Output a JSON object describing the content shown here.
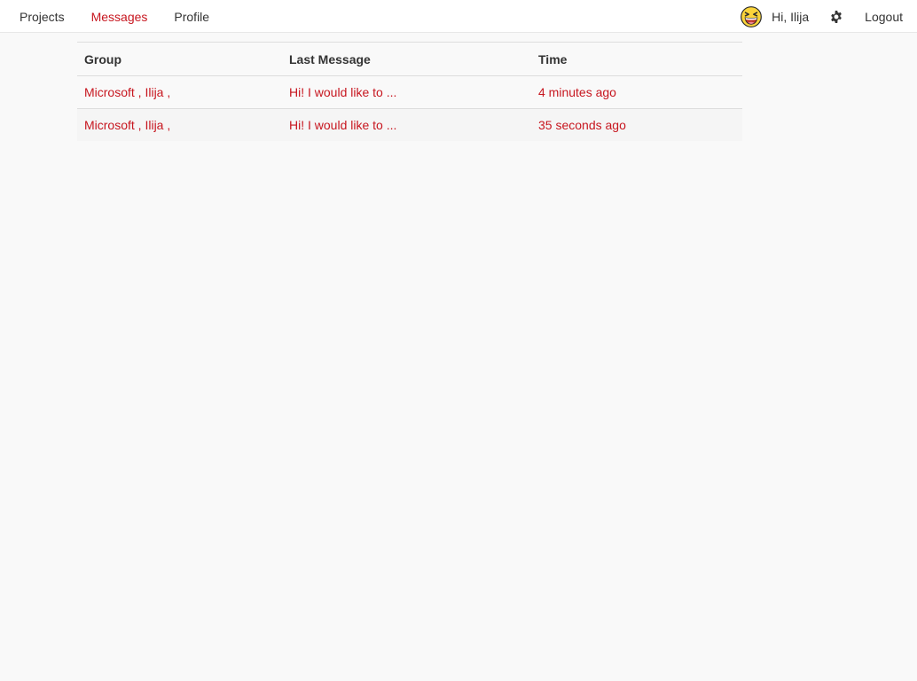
{
  "nav": {
    "links": [
      {
        "label": "Projects",
        "active": false
      },
      {
        "label": "Messages",
        "active": true
      },
      {
        "label": "Profile",
        "active": false
      }
    ],
    "greeting": "Hi, Ilija",
    "avatar_icon": "laughing-face-emoji-icon",
    "settings_icon": "gear-icon",
    "logout_label": "Logout"
  },
  "colors": {
    "accent": "#c7161f",
    "text": "#333333",
    "background": "#f9f9f9"
  },
  "table": {
    "headers": [
      "Group",
      "Last Message",
      "Time"
    ],
    "rows": [
      {
        "group": "Microsoft , Ilija ,",
        "last_message": "Hi! I would like to ...",
        "time": "4 minutes ago"
      },
      {
        "group": "Microsoft , Ilija ,",
        "last_message": "Hi! I would like to ...",
        "time": "35 seconds ago"
      }
    ]
  }
}
